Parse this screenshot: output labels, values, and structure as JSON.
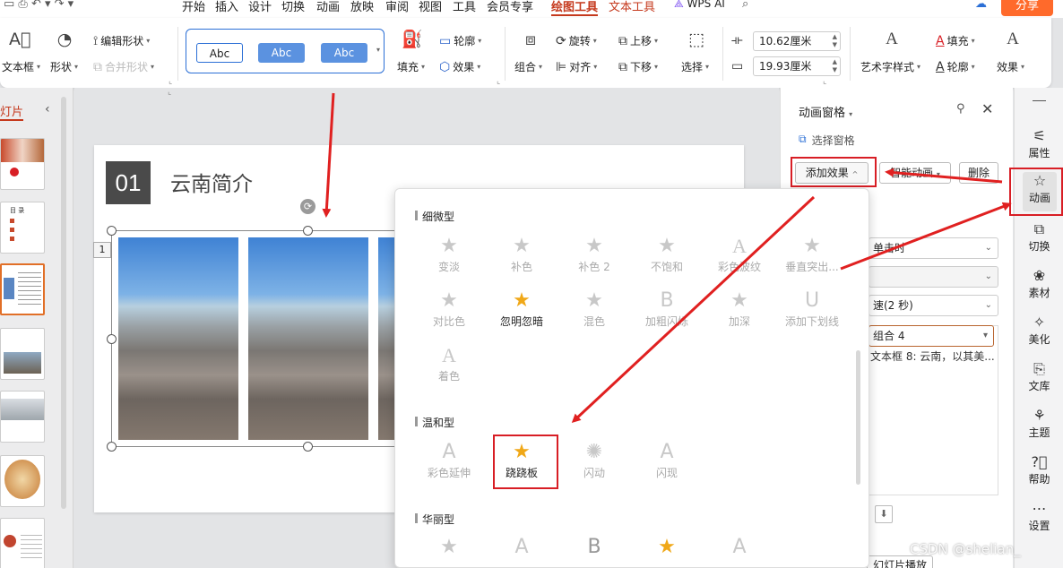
{
  "menu": {
    "items": [
      "开始",
      "插入",
      "设计",
      "切换",
      "动画",
      "放映",
      "审阅",
      "视图",
      "工具",
      "会员专享"
    ],
    "active": "绘图工具",
    "sub": "文本工具",
    "ai": "WPS AI",
    "share": "分享"
  },
  "ribbon": {
    "textbox": "文本框",
    "shape": "形状",
    "edit_shape": "编辑形状",
    "merge_shape": "合并形状",
    "style_samples": [
      "Abc",
      "Abc",
      "Abc"
    ],
    "fill": "填充",
    "outline": "轮廓",
    "effect": "效果",
    "group": "组合",
    "rotate": "旋转",
    "align": "对齐",
    "up": "上移",
    "down": "下移",
    "select": "选择",
    "width": "10.62厘米",
    "height": "19.93厘米",
    "art_style": "艺术字样式",
    "text_fill": "填充",
    "text_outline": "轮廓",
    "text_effect": "效果"
  },
  "left_panel": {
    "title": "灯片",
    "thumb_labels": [
      "目 录"
    ]
  },
  "slide": {
    "number": "01",
    "title": "云南简介",
    "anim_tag": "1"
  },
  "animation_panel": {
    "title": "动画窗格",
    "select_pane": "选择窗格",
    "add_effect": "添加效果",
    "smart_anim": "智能动画",
    "delete": "删除",
    "trigger": "单击时",
    "speed": "速(2 秒)",
    "item": "组合 4",
    "item2": "文本框 8: 云南，以其美...",
    "play": "幻灯片播放"
  },
  "right_bar": [
    {
      "icon": "sliders-icon",
      "label": "属性"
    },
    {
      "icon": "star-icon",
      "label": "动画"
    },
    {
      "icon": "switch-icon",
      "label": "切换"
    },
    {
      "icon": "material-icon",
      "label": "素材"
    },
    {
      "icon": "beautify-icon",
      "label": "美化"
    },
    {
      "icon": "library-icon",
      "label": "文库"
    },
    {
      "icon": "theme-icon",
      "label": "主题"
    },
    {
      "icon": "help-icon",
      "label": "帮助"
    },
    {
      "icon": "settings-icon",
      "label": "设置"
    }
  ],
  "popup": {
    "sections": [
      "细微型",
      "温和型",
      "华丽型"
    ],
    "subtle": [
      "变淡",
      "补色",
      "补色 2",
      "不饱和",
      "彩色波纹",
      "垂直突出...",
      "对比色",
      "忽明忽暗",
      "混色",
      "加粗闪烁",
      "加深",
      "添加下划线",
      "着色"
    ],
    "moderate": [
      "彩色延伸",
      "跷跷板",
      "闪动",
      "闪现"
    ],
    "subtle_glyphs": [
      "★",
      "★",
      "★",
      "★",
      "A",
      "★",
      "★",
      "★",
      "★",
      "B",
      "★",
      "U",
      "A"
    ],
    "moderate_glyphs": [
      "A",
      "★",
      "✺",
      "A"
    ],
    "fancy_glyphs": [
      "★",
      "A",
      "B",
      "★",
      "A"
    ]
  },
  "watermark": "CSDN @shelian_",
  "colors": {
    "accent_red": "#d81e25",
    "orange": "#ff6a2b",
    "blue": "#2b6fd6"
  }
}
